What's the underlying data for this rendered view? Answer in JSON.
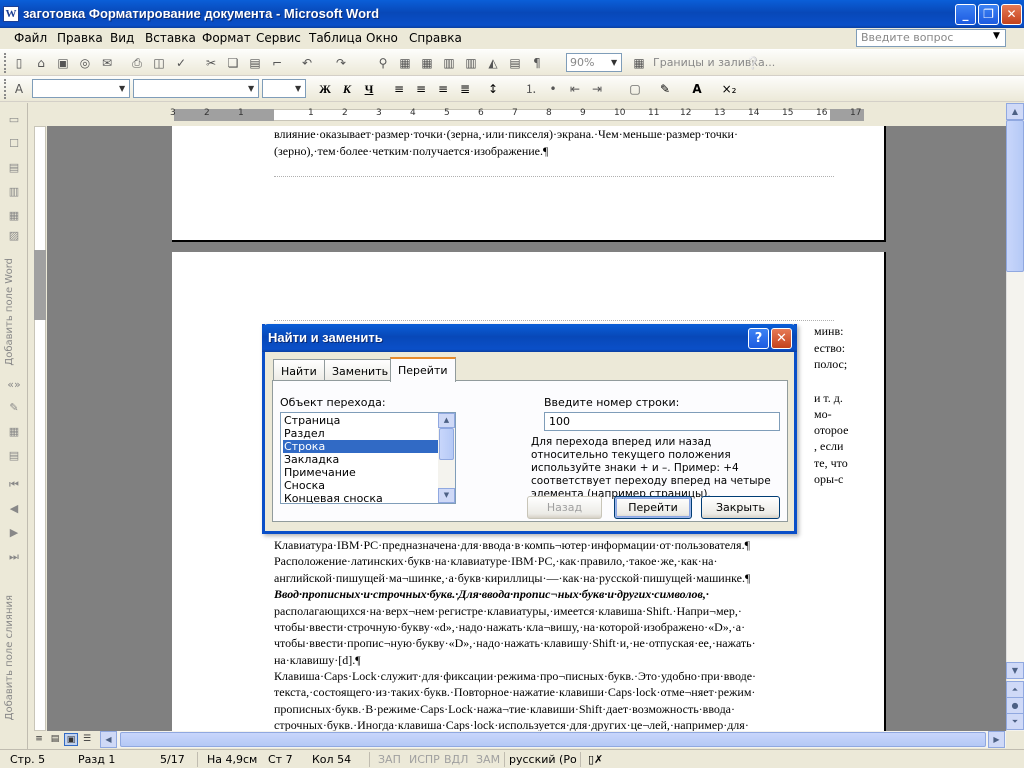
{
  "app": {
    "icon_letter": "W",
    "title": "заготовка Форматирование документа - Microsoft Word",
    "min": "_",
    "max": "❐",
    "close": "✕"
  },
  "menu": [
    "Файл",
    "Правка",
    "Вид",
    "Вставка",
    "Формат",
    "Сервис",
    "Таблица",
    "Окно",
    "Справка"
  ],
  "ask_placeholder": "Введите вопрос",
  "toolbar1": {
    "zoom": "90%",
    "borders_label": "Границы и заливка..."
  },
  "toolbar2": {
    "bold": "Ж",
    "italic": "К",
    "underline": "Ч"
  },
  "ruler_numbers": [
    "3",
    "2",
    "1",
    "1",
    "2",
    "3",
    "4",
    "5",
    "6",
    "7",
    "8",
    "9",
    "10",
    "11",
    "12",
    "13",
    "14",
    "15",
    "16",
    "17"
  ],
  "sidebar": {
    "label_top": "Добавить поле Word",
    "label_bottom": "Добавить поле слияния"
  },
  "page1_lines": [
    "влияние·оказывает·размер·точки·(зерна,·или·пикселя)·экрана.·Чем·меньше·размер·точки·",
    "(зерно),·тем·более·четким·получается·изображение.¶"
  ],
  "page2_right_fragments": [
    "минв:",
    "ество:",
    "полос;",
    "и т. д.",
    "мо-",
    "оторое",
    ", если",
    "те, что",
    "оры-с"
  ],
  "page2_lines": [
    "Клавиатура·IBM·PC·предназначена·для·ввода·в·компь¬ютер·информации·от·пользователя.¶",
    "Расположение·латинских·букв·на·клавиатуре·IBM·PC,·как·правило,·такое·же,·как·на·",
    "английской·пишущей·ма¬шинке,·а·букв·кириллицы·—·как·на·русской·пишущей·машинке.¶",
    "Ввод·прописных·и·строчных·букв.·Для·ввода·пропис¬ных·букв·и·других·символов,·",
    "располагающихся·на·верх¬нем·регистре·клавиатуры,·имеется·клавиша·Shift.·Напри¬мер,·",
    "чтобы·ввести·строчную·букву·«d»,·надо·нажать·кла¬вишу,·на·которой·изображено·«D»,·а·",
    "чтобы·ввести·пропис¬ную·букву·«D»,·надо·нажать·клавишу·Shift·и,·не·отпуская·ее,·нажать·",
    "на·клавишу·[d].¶",
    "Клавиша·Caps·Lock·служит·для·фиксации·режима·про¬писных·букв.·Это·удобно·при·вводе·",
    "текста,·состоящего·из·таких·букв.·Повторное·нажатие·клавиши·Caps·lock·отме¬няет·режим·",
    "прописных·букв.·В·режиме·Caps·Lock·нажа¬тие·клавиши·Shift·дает·возможность·ввода·",
    "строчных·букв.·Иногда·клавиша·Caps·lock·используется·для·других·це¬лей,·например·для·"
  ],
  "dialog": {
    "title": "Найти и заменить",
    "help": "?",
    "close": "✕",
    "tabs": [
      "Найти",
      "Заменить",
      "Перейти"
    ],
    "active_tab": "Перейти",
    "object_label": "Объект перехода:",
    "objects": [
      "Страница",
      "Раздел",
      "Строка",
      "Закладка",
      "Примечание",
      "Сноска",
      "Концевая сноска"
    ],
    "selected_object": "Строка",
    "line_label": "Введите номер строки:",
    "line_value": "100",
    "hint": "Для перехода вперед или назад относительно текущего положения используйте знаки + и –. Пример: +4 соответствует переходу вперед на четыре элемента (например страницы).",
    "buttons": {
      "back": "Назад",
      "go": "Перейти",
      "close": "Закрыть"
    }
  },
  "status": {
    "page": "Стр. 5",
    "section": "Разд 1",
    "pages": "5/17",
    "position": "На 4,9см",
    "line": "Ст 7",
    "column": "Кол 54",
    "rec": "ЗАП",
    "trk": "ИСПР",
    "ext": "ВДЛ",
    "ovr": "ЗАМ",
    "lang": "русский (Ро"
  }
}
